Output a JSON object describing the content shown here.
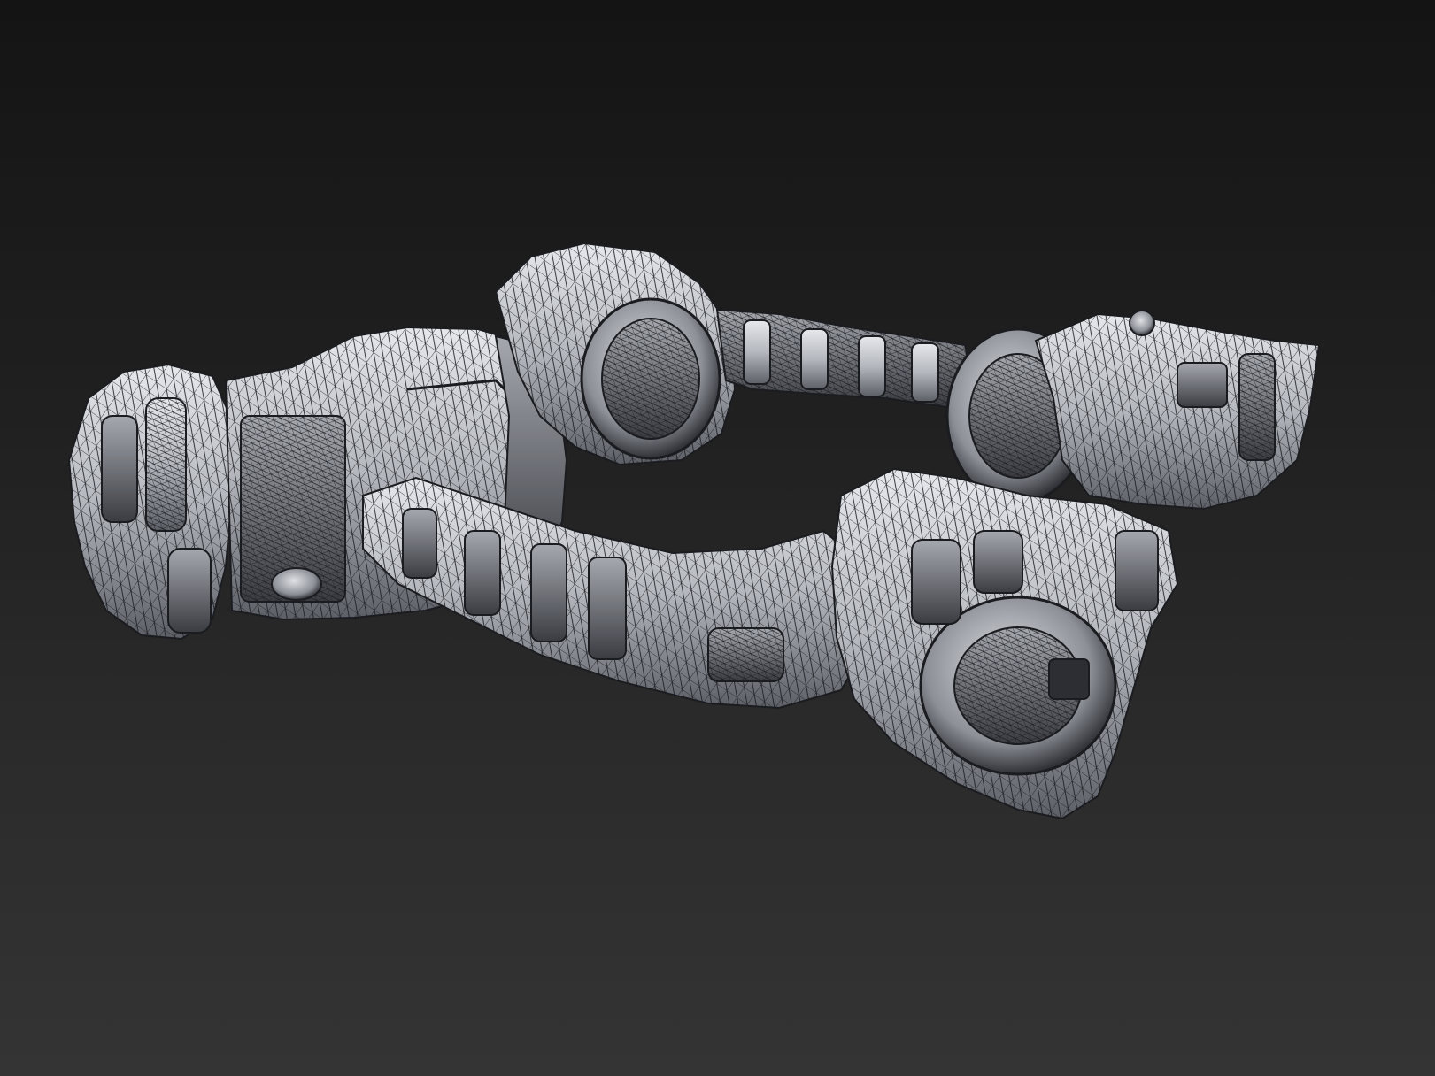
{
  "viewport": {
    "background_top": "#141414",
    "background_bottom": "#343434",
    "render_mode": "wireframe-on-shaded"
  },
  "model": {
    "icon": "mechanical-arms-mesh",
    "parts": [
      {
        "name": "left-fist"
      },
      {
        "name": "left-forearm"
      },
      {
        "name": "upper-elbow-joint"
      },
      {
        "name": "upper-linked-cable"
      },
      {
        "name": "right-shoulder-joint"
      },
      {
        "name": "right-gauntlet"
      },
      {
        "name": "lower-forearm"
      },
      {
        "name": "front-gauntlet"
      }
    ],
    "colors": {
      "mesh_light": "#d9dbe0",
      "mesh_mid": "#9a9da4",
      "mesh_dark": "#3a3c42",
      "wire": "#1b1c20"
    }
  }
}
